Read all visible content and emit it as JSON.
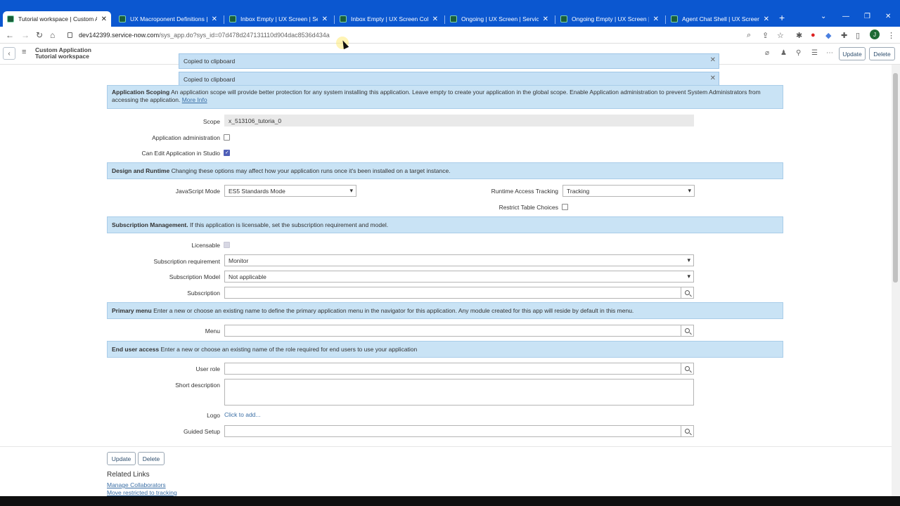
{
  "browser": {
    "tabs": [
      {
        "title": "Tutorial workspace | Custom Ap",
        "active": true
      },
      {
        "title": "UX Macroponent Definitions | S",
        "active": false
      },
      {
        "title": "Inbox Empty | UX Screen | Serv",
        "active": false
      },
      {
        "title": "Inbox Empty | UX Screen Collect",
        "active": false
      },
      {
        "title": "Ongoing | UX Screen | ServiceN",
        "active": false
      },
      {
        "title": "Ongoing Empty | UX Screen | Se",
        "active": false
      },
      {
        "title": "Agent Chat Shell | UX Screen | S",
        "active": false
      }
    ],
    "url_host": "dev142399.service-now.com",
    "url_path": "/sys_app.do?sys_id=07d478d247131110d904dac8536d434a",
    "profile_initial": "J"
  },
  "header": {
    "title_line1": "Custom Application",
    "title_line2": "Tutorial workspace",
    "update_label": "Update",
    "delete_label": "Delete"
  },
  "toasts": [
    "Copied to clipboard",
    "Copied to clipboard"
  ],
  "sections": {
    "scoping": {
      "heading": "Application Scoping",
      "text": "An application scope will provide better protection for any system installing this application. Leave empty to create your application in the global scope. Enable Application administration to prevent System Administrators from accessing the application.",
      "more_info": "More Info"
    },
    "design": {
      "heading": "Design and Runtime",
      "text": "Changing these options may affect how your application runs once it's been installed on a target instance."
    },
    "subscription": {
      "heading": "Subscription Management.",
      "text": "If this application is licensable, set the subscription requirement and model."
    },
    "primary_menu": {
      "heading": "Primary menu",
      "text": "Enter a new or choose an existing name to define the primary application menu in the navigator for this application. Any module created for this app will reside by default in this menu."
    },
    "end_user": {
      "heading": "End user access",
      "text": "Enter a new or choose an existing name of the role required for end users to use your application"
    }
  },
  "fields": {
    "scope": {
      "label": "Scope",
      "value": "x_513106_tutoria_0"
    },
    "app_admin": {
      "label": "Application administration",
      "checked": false
    },
    "can_edit": {
      "label": "Can Edit Application in Studio",
      "checked": true
    },
    "js_mode": {
      "label": "JavaScript Mode",
      "value": "ES5 Standards Mode"
    },
    "runtime_tracking": {
      "label": "Runtime Access Tracking",
      "value": "Tracking"
    },
    "restrict_table": {
      "label": "Restrict Table Choices",
      "checked": false
    },
    "licensable": {
      "label": "Licensable",
      "checked": false
    },
    "sub_requirement": {
      "label": "Subscription requirement",
      "value": "Monitor"
    },
    "sub_model": {
      "label": "Subscription Model",
      "value": "Not applicable"
    },
    "subscription": {
      "label": "Subscription",
      "value": ""
    },
    "menu": {
      "label": "Menu",
      "value": ""
    },
    "user_role": {
      "label": "User role",
      "value": ""
    },
    "short_description": {
      "label": "Short description",
      "value": ""
    },
    "logo": {
      "label": "Logo",
      "link": "Click to add..."
    },
    "guided_setup": {
      "label": "Guided Setup",
      "value": ""
    }
  },
  "footer": {
    "update_label": "Update",
    "delete_label": "Delete",
    "related_links_title": "Related Links",
    "links": [
      "Manage Collaborators",
      "Move restricted to tracking"
    ]
  }
}
